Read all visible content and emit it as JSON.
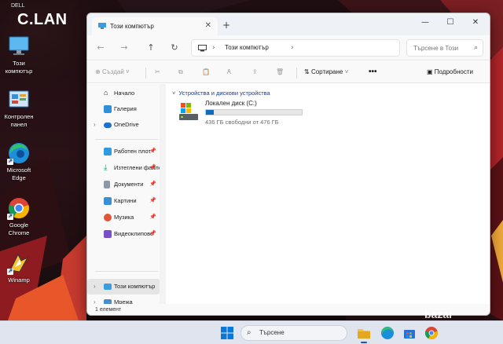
{
  "desktop": {
    "brand": "DELL",
    "logo_text": "C.LAN",
    "icons": [
      {
        "label": "Този компютър",
        "icon": "this-pc-icon"
      },
      {
        "label": "Контролен панел",
        "icon": "control-panel-icon"
      },
      {
        "label": "Microsoft Edge",
        "icon": "edge-icon"
      },
      {
        "label": "Google Chrome",
        "icon": "chrome-icon"
      },
      {
        "label": "Winamp",
        "icon": "winamp-icon"
      }
    ]
  },
  "window": {
    "tab_title": "Този компютър",
    "address": {
      "location": "Този компютър"
    },
    "search": {
      "placeholder": "Търсене в Този"
    },
    "toolbar": {
      "create": "Създай",
      "sort": "Сортиране",
      "more": "•••",
      "details": "Подробности"
    },
    "sidebar": {
      "items": [
        {
          "label": "Начало",
          "icon": "home-icon"
        },
        {
          "label": "Галерия",
          "icon": "gallery-icon"
        },
        {
          "label": "OneDrive",
          "icon": "onedrive-icon"
        },
        {
          "label": "Работен плот",
          "icon": "desktop-folder-icon"
        },
        {
          "label": "Изтеглени файлове",
          "icon": "downloads-icon"
        },
        {
          "label": "Документи",
          "icon": "documents-icon"
        },
        {
          "label": "Картини",
          "icon": "pictures-icon"
        },
        {
          "label": "Музика",
          "icon": "music-icon"
        },
        {
          "label": "Видеоклипове",
          "icon": "videos-icon"
        },
        {
          "label": "Този компютър",
          "icon": "this-pc-icon"
        },
        {
          "label": "Мрежа",
          "icon": "network-icon"
        }
      ]
    },
    "main": {
      "group_title": "Устройства и дискови устройства",
      "drive": {
        "name": "Локален диск (C:)",
        "free_text": "436 ГБ свободни от 476 ГБ",
        "used_fraction": 0.084,
        "fill_color": "#0f6cbd"
      }
    },
    "status": "1 елемент"
  },
  "taskbar": {
    "search_label": "Търсене",
    "apps": [
      "start-icon",
      "search-icon",
      "file-explorer-icon",
      "edge-icon",
      "store-icon",
      "chrome-icon"
    ]
  },
  "watermark": "bazar"
}
